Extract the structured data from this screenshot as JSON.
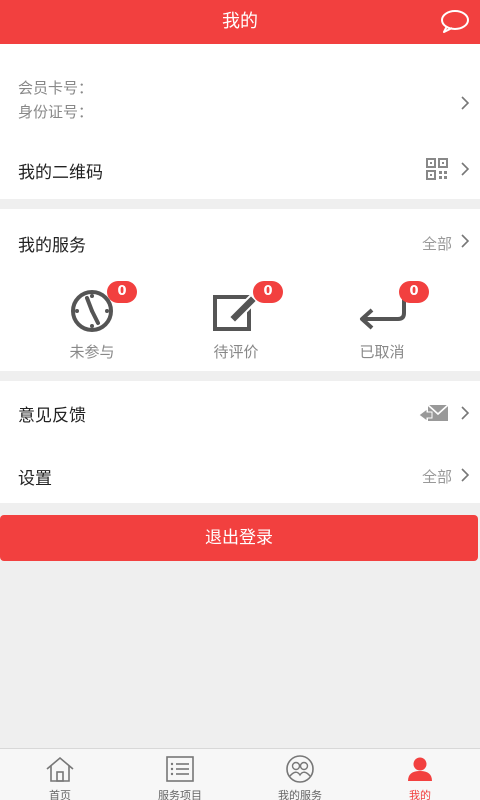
{
  "header": {
    "title": "我的",
    "icon": "message-bubble-icon"
  },
  "profile": {
    "card_label": "会员卡号：",
    "id_label": "身份证号："
  },
  "qrcode": {
    "label": "我的二维码",
    "icon": "qr-code-icon"
  },
  "services": {
    "title": "我的服务",
    "all_label": "全部",
    "items": [
      {
        "label": "未参与",
        "count": "0",
        "icon": "clock-icon"
      },
      {
        "label": "待评价",
        "count": "0",
        "icon": "edit-icon"
      },
      {
        "label": "已取消",
        "count": "0",
        "icon": "return-arrow-icon"
      }
    ]
  },
  "feedback": {
    "label": "意见反馈",
    "icon": "mail-send-icon"
  },
  "settings": {
    "label": "设置",
    "right_label": "全部"
  },
  "logout": {
    "label": "退出登录"
  },
  "tabbar": {
    "items": [
      {
        "label": "首页",
        "icon": "home-icon"
      },
      {
        "label": "服务项目",
        "icon": "list-icon"
      },
      {
        "label": "我的服务",
        "icon": "people-icon"
      },
      {
        "label": "我的",
        "icon": "person-icon"
      }
    ],
    "active_index": 3
  },
  "colors": {
    "accent": "#f2403f",
    "background": "#efefef"
  }
}
